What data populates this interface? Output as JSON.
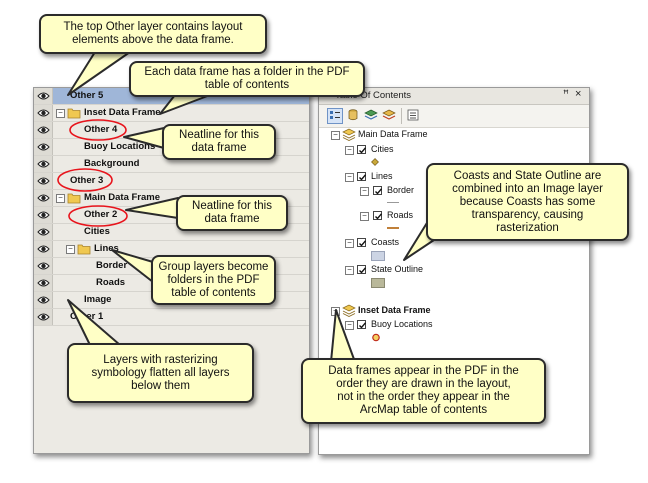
{
  "pdf_layers_panel": {
    "rows": [
      {
        "label": "Other 5",
        "selected": true
      },
      {
        "label": "Inset Data Frame"
      },
      {
        "label": "Other 4"
      },
      {
        "label": "Buoy Locations"
      },
      {
        "label": "Background"
      },
      {
        "label": "Other 3"
      },
      {
        "label": "Main Data Frame"
      },
      {
        "label": "Other 2"
      },
      {
        "label": "Cities"
      },
      {
        "label": "Lines"
      },
      {
        "label": "Border"
      },
      {
        "label": "Roads"
      },
      {
        "label": "Image"
      },
      {
        "label": "Other 1"
      }
    ]
  },
  "arcmap_toc": {
    "title": "Table Of Contents",
    "main_frame": "Main Data Frame",
    "cities": "Cities",
    "lines": "Lines",
    "border": "Border",
    "roads": "Roads",
    "coasts": "Coasts",
    "state_outline": "State Outline",
    "inset_frame": "Inset Data Frame",
    "buoy_locations": "Buoy Locations"
  },
  "callouts": {
    "top_other": [
      "The top Other layer contains layout",
      "elements above the data frame."
    ],
    "folder": [
      "Each data frame has a folder in the PDF",
      "table of contents"
    ],
    "neatline_1": [
      "Neatline for this",
      "data frame"
    ],
    "neatline_2": [
      "Neatline for this",
      "data frame"
    ],
    "group_layers": [
      "Group layers become",
      "folders in the PDF",
      "table of contents"
    ],
    "rasterize": [
      "Layers with rasterizing",
      "symbology flatten all layers",
      "below them"
    ],
    "coasts": [
      "Coasts and State Outline are",
      "combined into an Image layer",
      "because Coasts has some",
      "transparency, causing",
      "rasterization"
    ],
    "order": [
      "Data frames appear in the PDF in the",
      "order they are drawn in the layout,",
      "not in the order they appear in the",
      "ArcMap table of contents"
    ]
  },
  "colors": {
    "callout_fill": "#ffffc6",
    "selected_row": "#9fb6d8",
    "highlight_circle": "#e8141c",
    "folder": "#f0c850"
  }
}
